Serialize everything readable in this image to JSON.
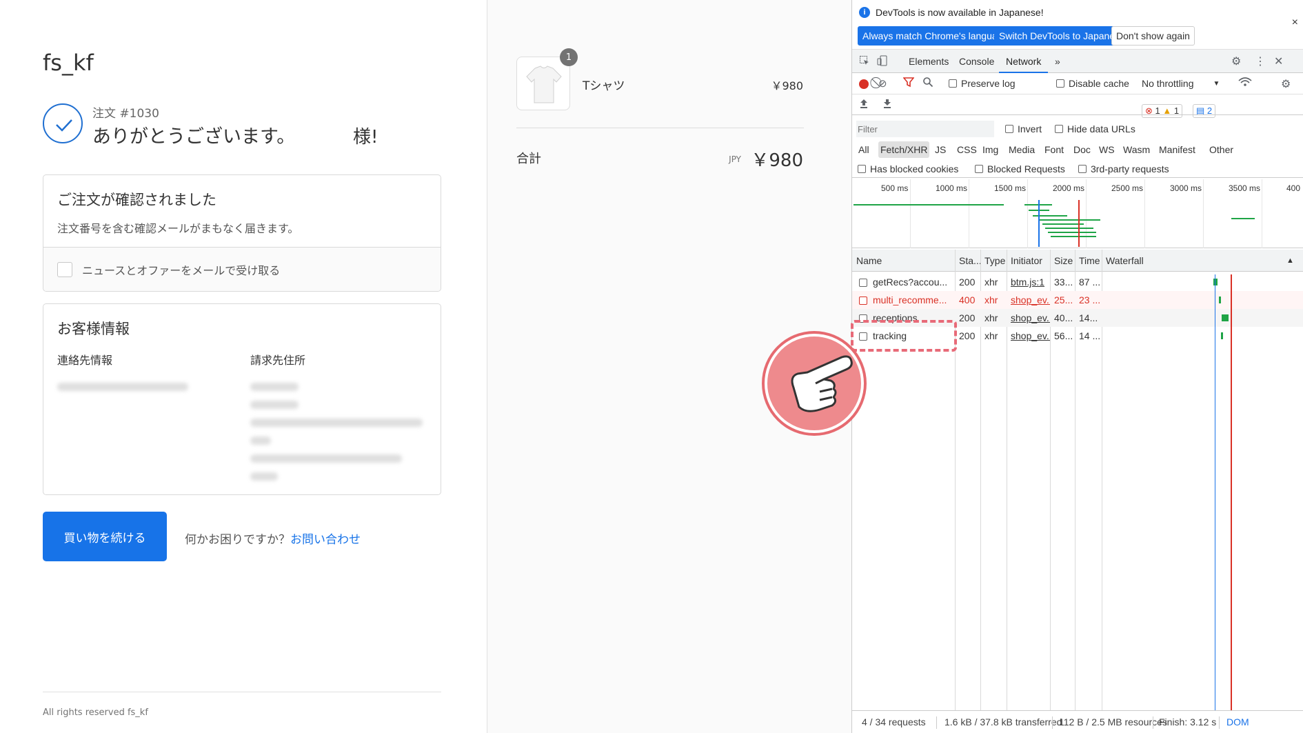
{
  "shop": {
    "store_name": "fs_kf",
    "order_number": "注文 #1030",
    "thanks": "ありがとうございます。",
    "thanks_suffix": "様!",
    "confirm_title": "ご注文が確認されました",
    "confirm_sub": "注文番号を含む確認メールがまもなく届きます。",
    "newsletter_label": "ニュースとオファーをメールで受け取る",
    "customer_title": "お客様情報",
    "contact_heading": "連絡先情報",
    "billing_heading": "請求先住所",
    "continue_button": "買い物を続ける",
    "help_text": "何かお困りですか？",
    "help_link": "お問い合わせ",
    "footer": "All rights reserved fs_kf"
  },
  "summary": {
    "quantity": "1",
    "product_name": "Tシャツ",
    "product_price": "￥980",
    "total_label": "合計",
    "currency": "JPY",
    "total_value": "￥980"
  },
  "devtools": {
    "banner_text": "DevTools is now available in Japanese!",
    "btn_always_match": "Always match Chrome's language",
    "btn_switch": "Switch DevTools to Japanese",
    "btn_dont_show": "Don't show again",
    "banner_close": "×",
    "tabs": [
      "Elements",
      "Console",
      "Network"
    ],
    "more_tabs": "»",
    "errors_count": "1",
    "warnings_count": "1",
    "messages_count": "2",
    "preserve_log": "Preserve log",
    "disable_cache": "Disable cache",
    "throttling": "No throttling",
    "filter_placeholder": "Filter",
    "invert": "Invert",
    "hide_data_urls": "Hide data URLs",
    "types": [
      "All",
      "Fetch/XHR",
      "JS",
      "CSS",
      "Img",
      "Media",
      "Font",
      "Doc",
      "WS",
      "Wasm",
      "Manifest",
      "Other"
    ],
    "selected_type": "Fetch/XHR",
    "has_blocked_cookies": "Has blocked cookies",
    "blocked_requests": "Blocked Requests",
    "third_party": "3rd-party requests",
    "overview_ticks": [
      "500 ms",
      "1000 ms",
      "1500 ms",
      "2000 ms",
      "2500 ms",
      "3000 ms",
      "3500 ms",
      "400"
    ],
    "columns": [
      "Name",
      "Sta...",
      "Type",
      "Initiator",
      "Size",
      "Time",
      "Waterfall"
    ],
    "requests": [
      {
        "name": "getRecs?accou...",
        "status": "200",
        "type": "xhr",
        "initiator": "btm.js:1",
        "size": "33...",
        "time": "87 ...",
        "error": false
      },
      {
        "name": "multi_recomme...",
        "status": "400",
        "type": "xhr",
        "initiator": "shop_ev...",
        "size": "25...",
        "time": "23 ...",
        "error": true
      },
      {
        "name": "receptions",
        "status": "200",
        "type": "xhr",
        "initiator": "shop_ev...",
        "size": "40...",
        "time": "14...",
        "error": false
      },
      {
        "name": "tracking",
        "status": "200",
        "type": "xhr",
        "initiator": "shop_ev...",
        "size": "56...",
        "time": "14 ...",
        "error": false
      }
    ],
    "status_bar": {
      "requests": "4 / 34 requests",
      "transferred": "1.6 kB / 37.8 kB transferred",
      "resources": "112 B / 2.5 MB resources",
      "finish": "Finish: 3.12 s",
      "dom": "DOM"
    },
    "colors": {
      "accent": "#1a73e8",
      "error": "#d93025",
      "bar": "#1ea446"
    }
  },
  "annotation": {
    "pointer_icon": "pointing-hand-icon"
  }
}
